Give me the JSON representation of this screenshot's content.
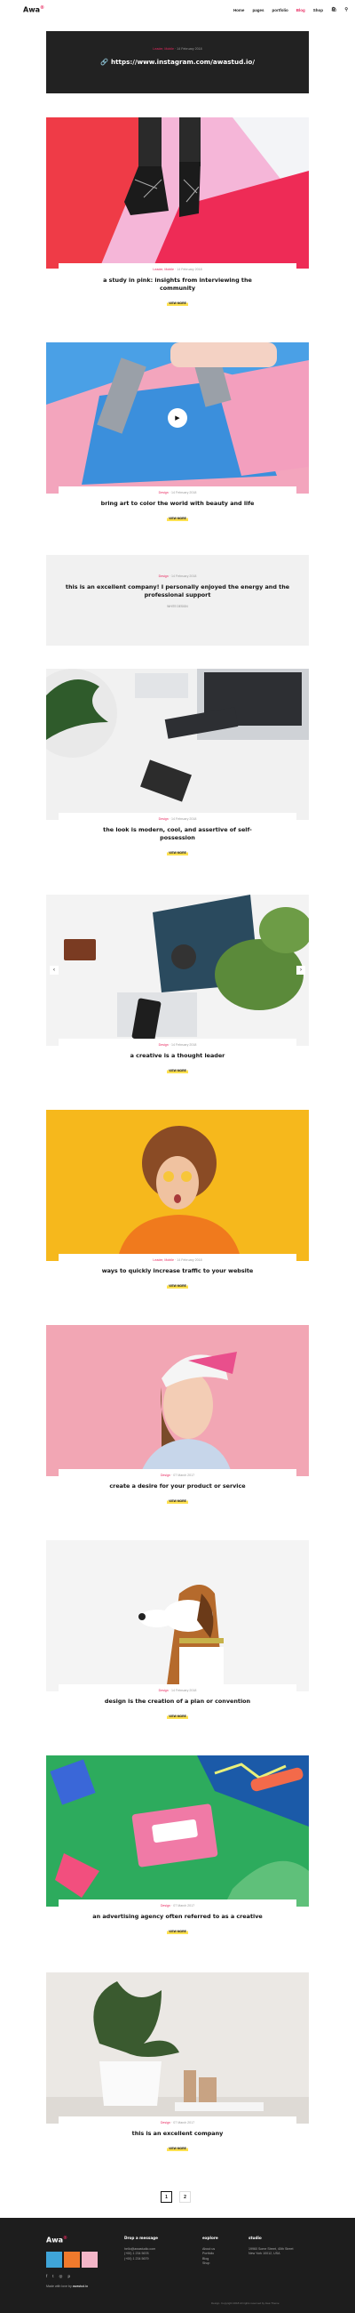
{
  "header": {
    "logo": "Awa",
    "logo_mark": "®",
    "nav": [
      "Home",
      "pages",
      "portfolio",
      "Blog",
      "Shop"
    ],
    "active_nav": "Blog"
  },
  "link_post": {
    "category": "Leader, Mobile",
    "date": "14 February 2018",
    "url": "https://www.instagram.com/awastud.io/"
  },
  "posts": [
    {
      "category": "Leader, Mobile",
      "date": "14 February 2018",
      "title": "a study in pink: insights from interviewing the community",
      "more": "VIEW MORE"
    },
    {
      "category": "Design",
      "date": "14 February 2018",
      "title": "bring art to color the world with beauty and life",
      "more": "VIEW MORE"
    },
    {
      "category": "Design",
      "date": "14 February 2018",
      "title": "this is an excellent company! I personally enjoyed the energy and the professional support",
      "author": "WHITE DESIGN"
    },
    {
      "category": "Design",
      "date": "14 February 2018",
      "title": "the look is modern, cool, and assertive of self-possession",
      "more": "VIEW MORE"
    },
    {
      "category": "Design",
      "date": "14 February 2018",
      "title": "a creative is a thought leader",
      "more": "VIEW MORE"
    },
    {
      "category": "Leader, Mobile",
      "date": "14 February 2018",
      "title": "ways to quickly increase traffic to your website",
      "more": "VIEW MORE"
    },
    {
      "category": "Design",
      "date": "07 March 2017",
      "title": "create a desire for your product or service",
      "more": "VIEW MORE"
    },
    {
      "category": "Design",
      "date": "14 February 2018",
      "title": "design is the creation of a plan or convention",
      "more": "VIEW MORE"
    },
    {
      "category": "Design",
      "date": "07 March 2017",
      "title": "an advertising agency often referred to as a creative",
      "more": "VIEW MORE"
    },
    {
      "category": "Design",
      "date": "07 March 2017",
      "title": "this is an excellent company",
      "more": "VIEW MORE"
    }
  ],
  "pagination": {
    "pages": [
      "1",
      "2"
    ],
    "current": "1"
  },
  "footer": {
    "logo": "Awa",
    "drop_title": "Drop a message",
    "drop_lines": [
      "hello@awastudio.com",
      "(+00) 1 234 5678",
      "(+00) 1 234 5679"
    ],
    "explore_title": "explore",
    "explore_links": [
      "About us",
      "Portfolio",
      "Blog",
      "Shop"
    ],
    "studio_title": "studio",
    "studio_lines": [
      "19960 Some Street, 40th Street",
      "New York 10012, USA"
    ],
    "made_by_prefix": "Made with love by",
    "made_by": "awastud.io",
    "copyright": "Design. Copyright 2018 All rights reserved by Awa Theme"
  }
}
